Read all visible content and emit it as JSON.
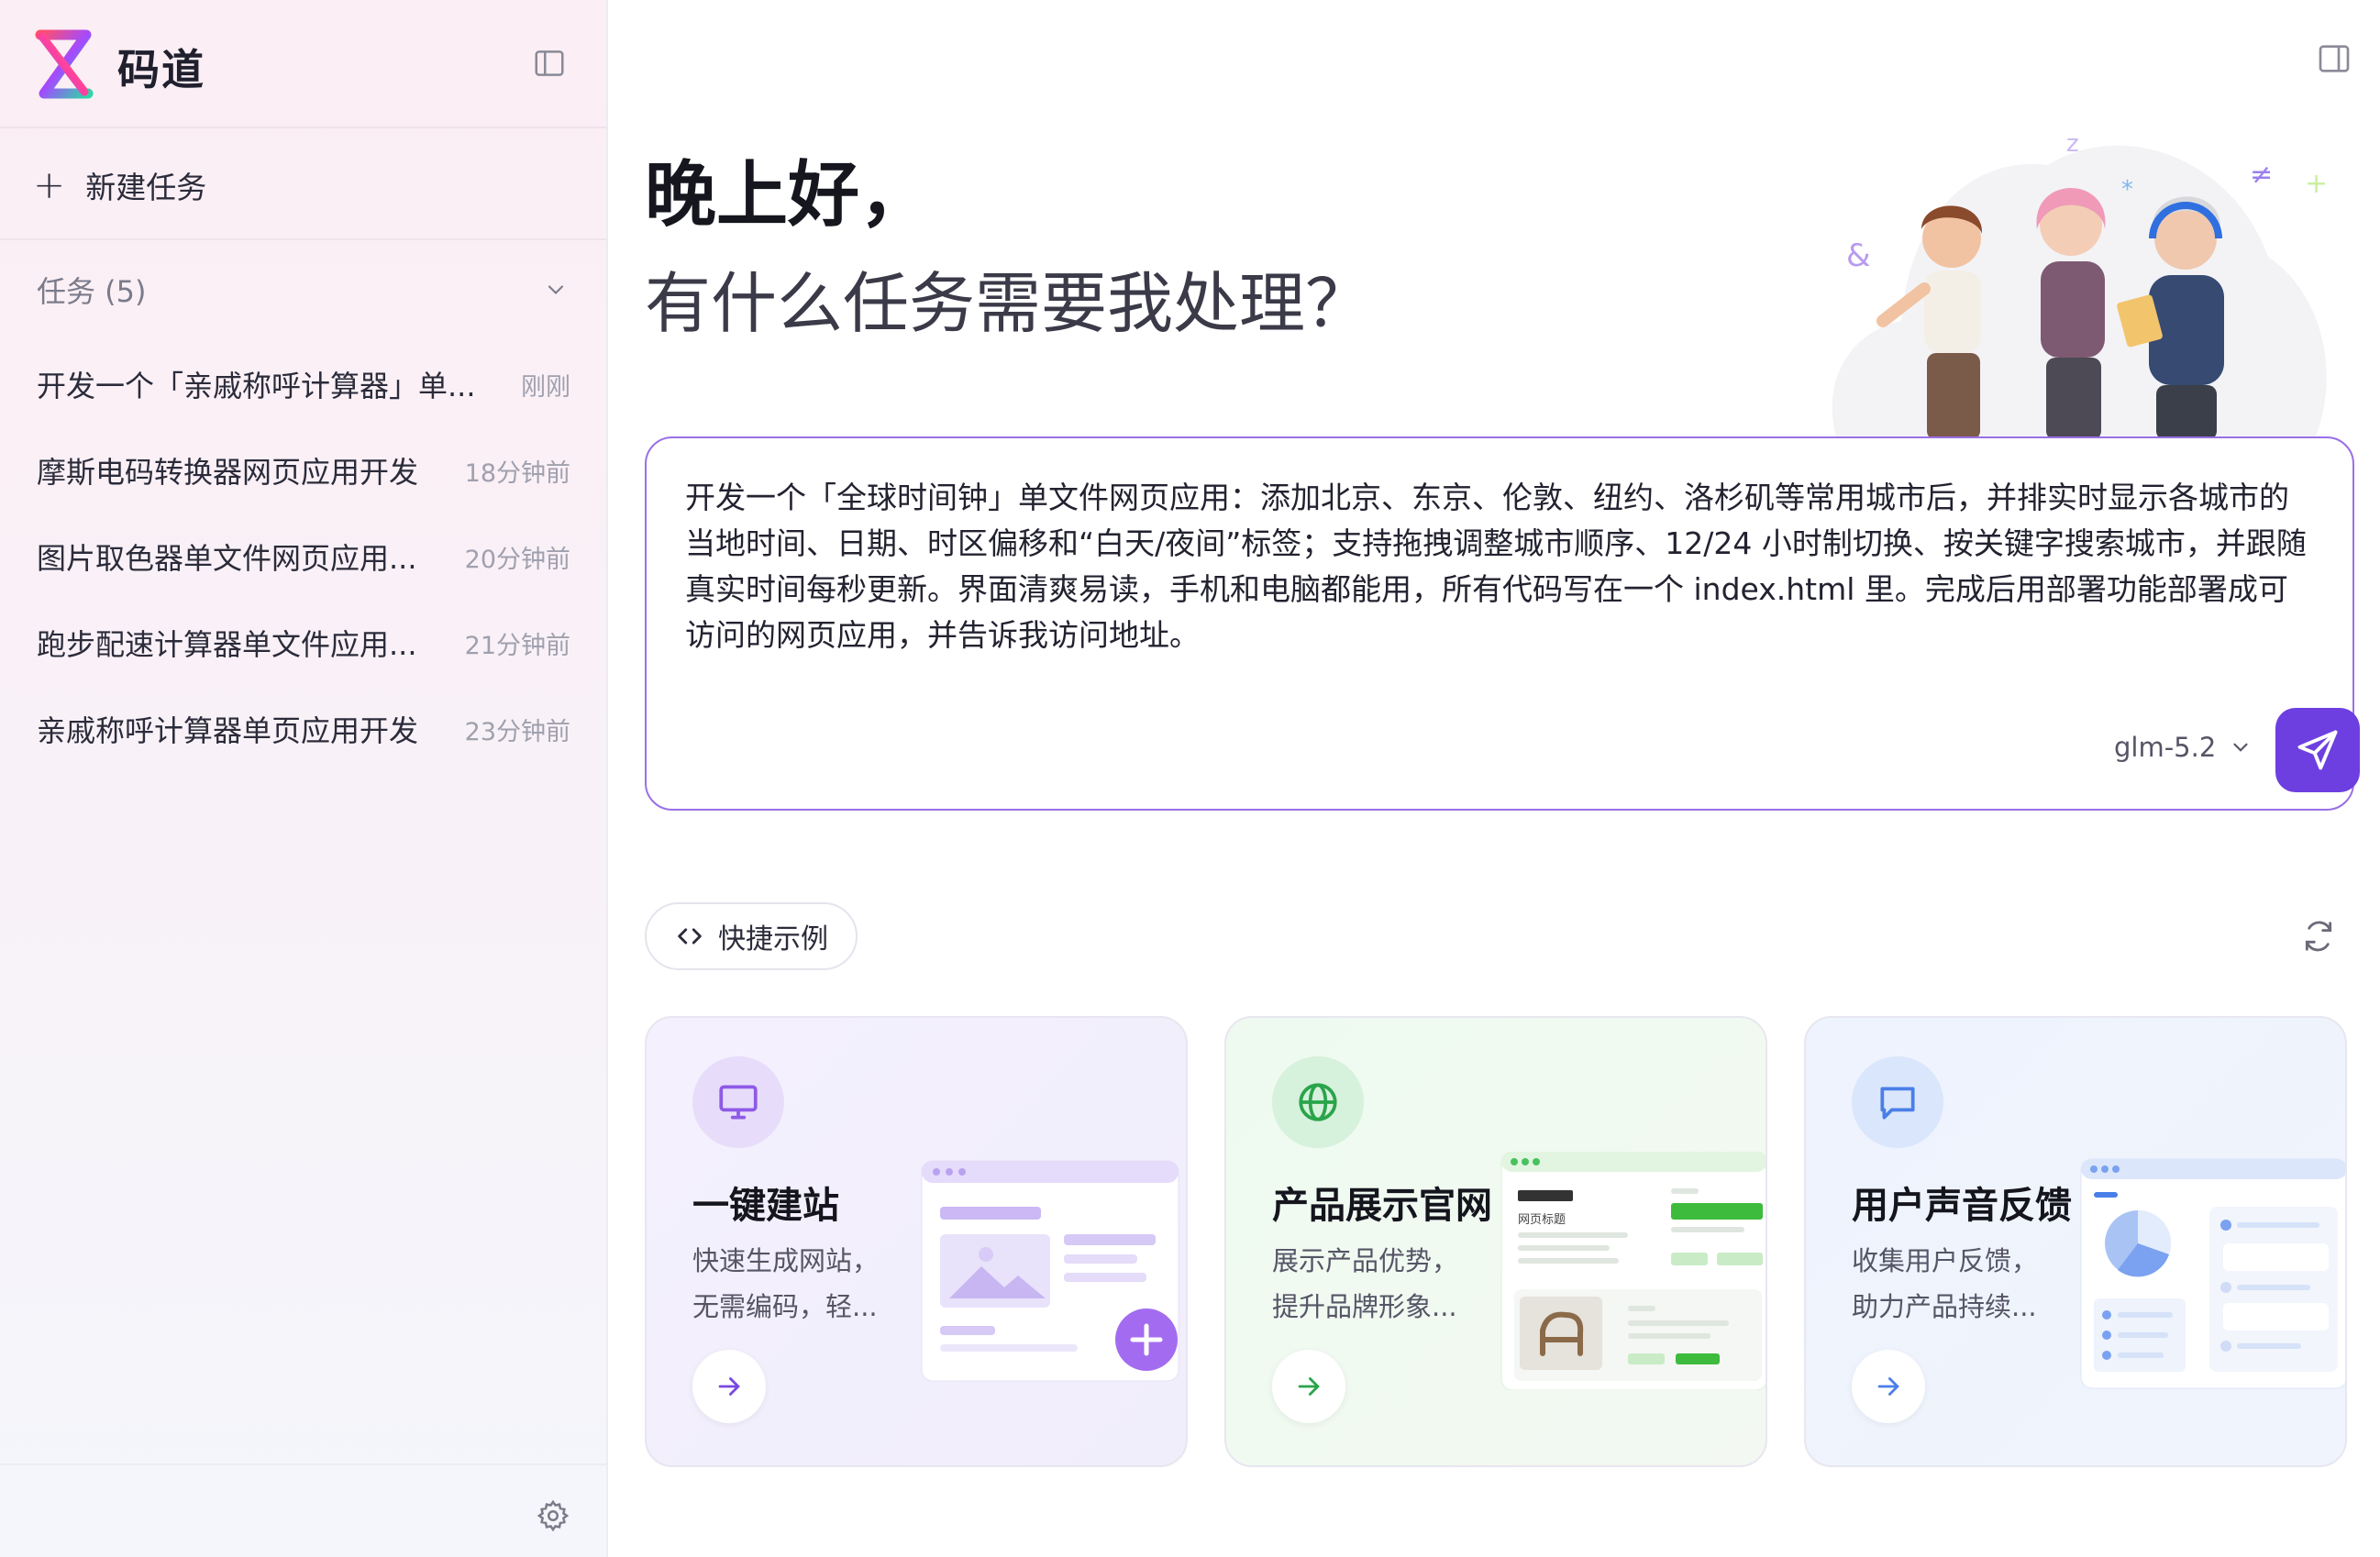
{
  "app": {
    "title": "码道"
  },
  "sidebar": {
    "new_task_label": "新建任务",
    "tasks_header": "任务 (5)",
    "tasks": [
      {
        "title": "开发一个「亲戚称呼计算器」单...",
        "time": "刚刚"
      },
      {
        "title": "摩斯电码转换器网页应用开发",
        "time": "18分钟前"
      },
      {
        "title": "图片取色器单文件网页应用...",
        "time": "20分钟前"
      },
      {
        "title": "跑步配速计算器单文件应用...",
        "time": "21分钟前"
      },
      {
        "title": "亲戚称呼计算器单页应用开发",
        "time": "23分钟前"
      }
    ]
  },
  "main": {
    "greeting_line1": "晚上好，",
    "greeting_line2": "有什么任务需要我处理？",
    "prompt": {
      "value": "开发一个「全球时间钟」单文件网页应用：添加北京、东京、伦敦、纽约、洛杉矶等常用城市后，并排实时显示各城市的当地时间、日期、时区偏移和“白天/夜间”标签；支持拖拽调整城市顺序、12/24 小时制切换、按关键字搜索城市，并跟随真实时间每秒更新。界面清爽易读，手机和电脑都能用，所有代码写在一个 index.html 里。完成后用部署功能部署成可访问的网页应用，并告诉我访问地址。",
      "model": "glm-5.2"
    },
    "quick_examples_label": "快捷示例",
    "cards": [
      {
        "title": "一键建站",
        "desc": "快速生成网站，无需编码，轻...",
        "preview_text": ""
      },
      {
        "title": "产品展示官网",
        "desc": "展示产品优势，提升品牌形象...",
        "preview_text": "网页标题"
      },
      {
        "title": "用户声音反馈",
        "desc": "收集用户反馈，助力产品持续...",
        "preview_text": ""
      }
    ]
  },
  "colors": {
    "accent": "#6d3fe0",
    "border_accent": "#9b6fe6",
    "green": "#2fbf4f",
    "blue": "#4a7fe8"
  }
}
